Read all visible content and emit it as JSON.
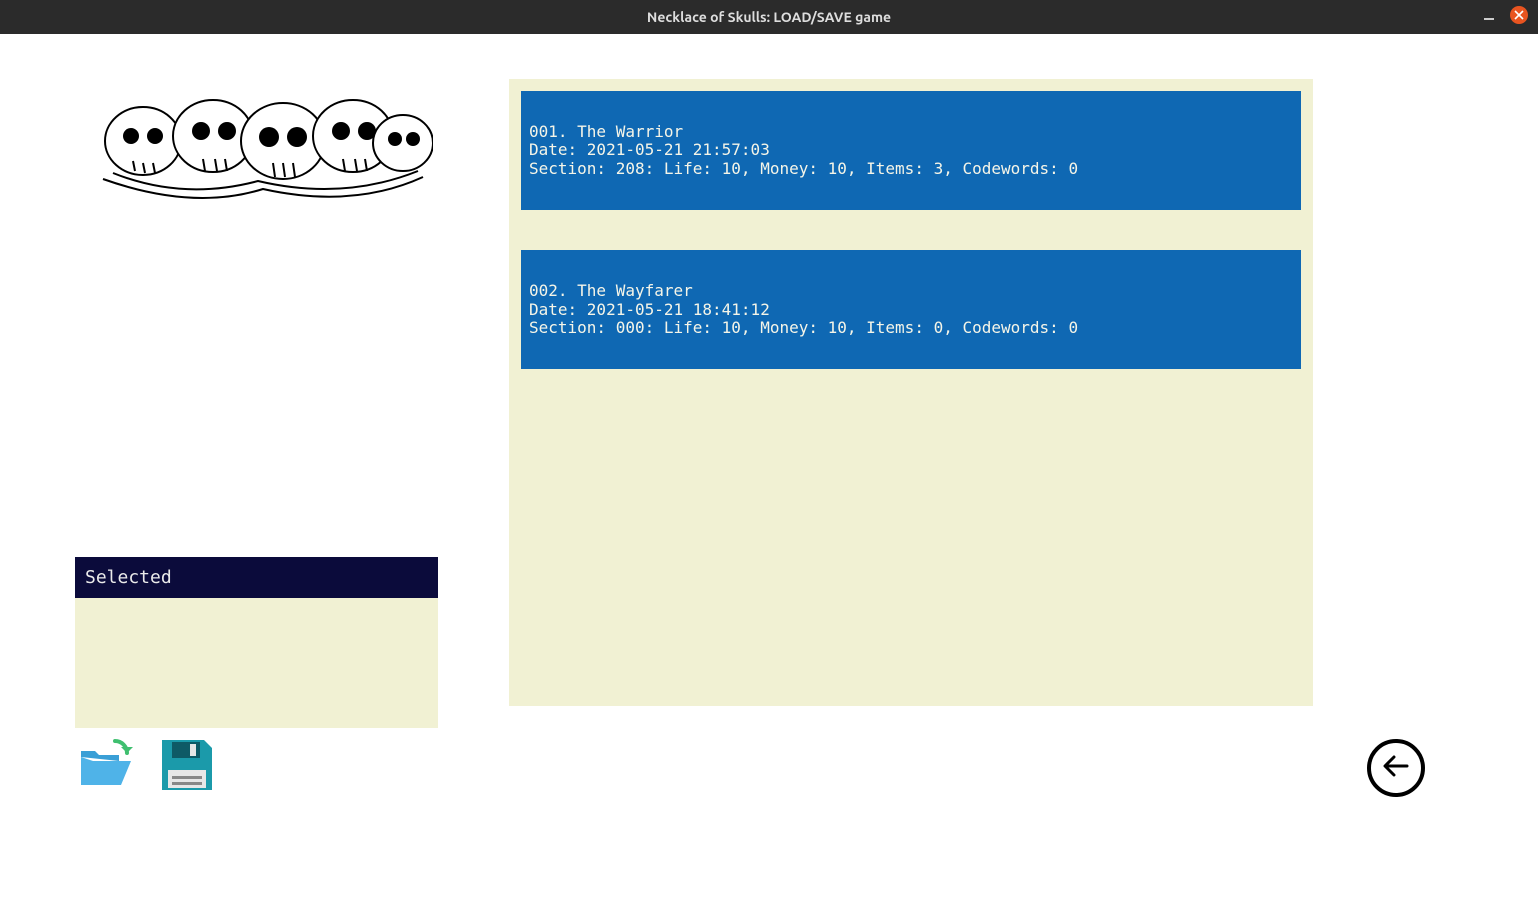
{
  "window": {
    "title": "Necklace of Skulls: LOAD/SAVE game"
  },
  "selected": {
    "header": "Selected",
    "value": ""
  },
  "colors": {
    "slot_bg": "#0f68b3",
    "slot_fg": "#f5f5e8",
    "panel_bg": "#f1f1d3",
    "selected_header_bg": "#0b0b3b"
  },
  "saves": [
    {
      "index": "001",
      "name": "The Warrior",
      "date": "2021-05-21 21:57:03",
      "section": "208",
      "life": 10,
      "money": 10,
      "items": 3,
      "codewords": 0,
      "display": "001. The Warrior\nDate: 2021-05-21 21:57:03\nSection: 208: Life: 10, Money: 10, Items: 3, Codewords: 0"
    },
    {
      "index": "002",
      "name": "The Wayfarer",
      "date": "2021-05-21 18:41:12",
      "section": "000",
      "life": 10,
      "money": 10,
      "items": 0,
      "codewords": 0,
      "display": "002. The Wayfarer\nDate: 2021-05-21 18:41:12\nSection: 000: Life: 10, Money: 10, Items: 0, Codewords: 0"
    }
  ],
  "icons": {
    "load": "folder-open-icon",
    "save": "floppy-icon",
    "back": "arrow-left-icon"
  }
}
